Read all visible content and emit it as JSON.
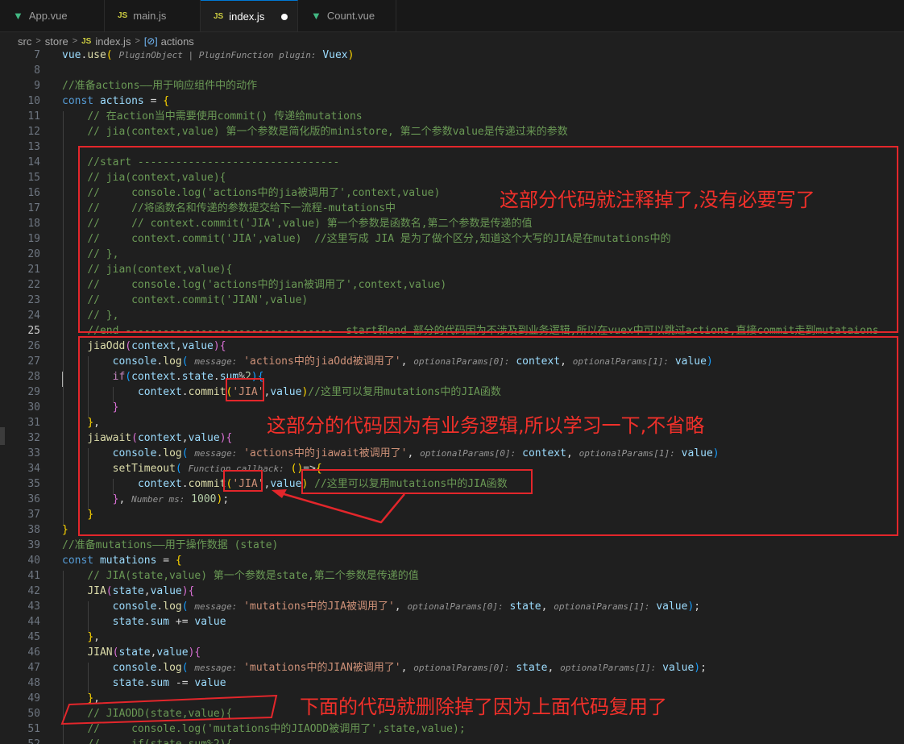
{
  "tabs": [
    {
      "label": "App.vue",
      "icon": "vue-file-icon",
      "icon_text": "▼"
    },
    {
      "label": "main.js",
      "icon": "js-file-icon",
      "icon_text": "JS"
    },
    {
      "label": "index.js",
      "icon": "js-file-icon",
      "icon_text": "JS",
      "active": true,
      "unsaved": true
    },
    {
      "label": "Count.vue",
      "icon": "vue-file-icon",
      "icon_text": "▼"
    }
  ],
  "breadcrumb": {
    "items": [
      "src",
      "store",
      "index.js",
      "actions"
    ],
    "separator": ">",
    "js_badge": "JS",
    "symbol_badge": "[⊘]"
  },
  "colors": {
    "comment": "#6a9955",
    "keyword": "#569cd6",
    "variable": "#9cdcfe",
    "function": "#dcdcaa",
    "string": "#ce9178",
    "number": "#b5cea8",
    "bracket_gold": "#ffd700",
    "bracket_purple": "#da70d6",
    "bracket_blue": "#179fff",
    "control": "#c586c0",
    "inlay_hint": "#969696",
    "annotation": "#e3262b"
  },
  "current_line": "25",
  "code_lines": [
    {
      "n": "7",
      "t": "vue.use( PluginObject | PluginFunction plugin: Vuex)"
    },
    {
      "n": "8",
      "t": ""
    },
    {
      "n": "9",
      "t": "//准备actions——用于响应组件中的动作"
    },
    {
      "n": "10",
      "t": "const actions = {"
    },
    {
      "n": "11",
      "t": "    // 在action当中需要使用commit() 传递给mutations"
    },
    {
      "n": "12",
      "t": "    // jia(context,value) 第一个参数是简化版的ministore, 第二个参数value是传递过来的参数"
    },
    {
      "n": "13",
      "t": ""
    },
    {
      "n": "14",
      "t": "    //start --------------------------------"
    },
    {
      "n": "15",
      "t": "    // jia(context,value){"
    },
    {
      "n": "16",
      "t": "    //     console.log('actions中的jia被调用了',context,value)"
    },
    {
      "n": "17",
      "t": "    //     //将函数名和传递的参数提交给下一流程-mutations中"
    },
    {
      "n": "18",
      "t": "    //     // context.commit('JIA',value) 第一个参数是函数名,第二个参数是传递的值"
    },
    {
      "n": "19",
      "t": "    //     context.commit('JIA',value)  //这里写成 JIA 是为了做个区分,知道这个大写的JIA是在mutations中的"
    },
    {
      "n": "20",
      "t": "    // },"
    },
    {
      "n": "21",
      "t": "    // jian(context,value){"
    },
    {
      "n": "22",
      "t": "    //     console.log('actions中的jian被调用了',context,value)"
    },
    {
      "n": "23",
      "t": "    //     context.commit('JIAN',value)"
    },
    {
      "n": "24",
      "t": "    // },"
    },
    {
      "n": "25",
      "t": "    //end ---------------------------------  start和end 部分的代码因为不涉及到业务逻辑,所以在vuex中可以跳过actions,直接commit走到mutataions"
    },
    {
      "n": "26",
      "t": "    jiaOdd(context,value){"
    },
    {
      "n": "27",
      "t": "        console.log( message: 'actions中的jiaOdd被调用了', optionalParams[0]: context, optionalParams[1]: value)"
    },
    {
      "n": "28",
      "t": "        if(context.state.sum%2){"
    },
    {
      "n": "29",
      "t": "            context.commit('JIA',value)//这里可以复用mutations中的JIA函数"
    },
    {
      "n": "30",
      "t": "        }"
    },
    {
      "n": "31",
      "t": "    },"
    },
    {
      "n": "32",
      "t": "    jiawait(context,value){"
    },
    {
      "n": "33",
      "t": "        console.log( message: 'actions中的jiawait被调用了', optionalParams[0]: context, optionalParams[1]: value)"
    },
    {
      "n": "34",
      "t": "        setTimeout( Function callback: ()=>{"
    },
    {
      "n": "35",
      "t": "            context.commit('JIA',value) //这里可以复用mutations中的JIA函数"
    },
    {
      "n": "36",
      "t": "        }, Number ms: 1000);"
    },
    {
      "n": "37",
      "t": "    }"
    },
    {
      "n": "38",
      "t": "}"
    },
    {
      "n": "39",
      "t": "//准备mutations——用于操作数据 (state)"
    },
    {
      "n": "40",
      "t": "const mutations = {"
    },
    {
      "n": "41",
      "t": "    // JIA(state,value) 第一个参数是state,第二个参数是传递的值"
    },
    {
      "n": "42",
      "t": "    JIA(state,value){"
    },
    {
      "n": "43",
      "t": "        console.log( message: 'mutations中的JIA被调用了', optionalParams[0]: state, optionalParams[1]: value);"
    },
    {
      "n": "44",
      "t": "        state.sum += value"
    },
    {
      "n": "45",
      "t": "    },"
    },
    {
      "n": "46",
      "t": "    JIAN(state,value){"
    },
    {
      "n": "47",
      "t": "        console.log( message: 'mutations中的JIAN被调用了', optionalParams[0]: state, optionalParams[1]: value);"
    },
    {
      "n": "48",
      "t": "        state.sum -= value"
    },
    {
      "n": "49",
      "t": "    },"
    },
    {
      "n": "50",
      "t": "    // JIAODD(state,value){"
    },
    {
      "n": "51",
      "t": "    //     console.log('mutations中的JIAODD被调用了',state,value);"
    },
    {
      "n": "52",
      "t": "    //     if(state.sum%2){"
    }
  ],
  "annotations": {
    "top_note": "这部分代码就注释掉了,没有必要写了",
    "middle_note": "这部分的代码因为有业务逻辑,所以学习一下,不省略",
    "bottom_note": "下面的代码就删除掉了因为上面代码复用了"
  }
}
